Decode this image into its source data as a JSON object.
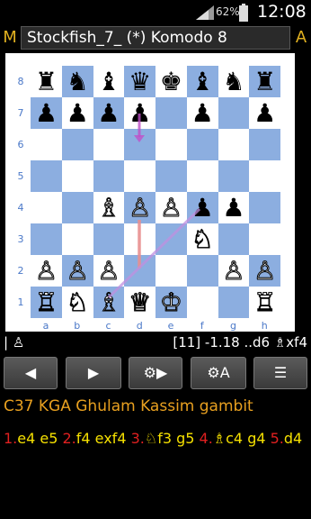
{
  "status": {
    "battery_pct": "62%",
    "time": "12:08"
  },
  "title": {
    "left_btn": "M",
    "text": "Stockfish_7_ (*) Komodo 8",
    "right_btn": "A"
  },
  "board": {
    "ranks": [
      "8",
      "7",
      "6",
      "5",
      "4",
      "3",
      "2",
      "1"
    ],
    "files": [
      "a",
      "b",
      "c",
      "d",
      "e",
      "f",
      "g",
      "h"
    ],
    "pieces": [
      {
        "sq": "a8",
        "p": "♜",
        "c": "b"
      },
      {
        "sq": "b8",
        "p": "♞",
        "c": "b"
      },
      {
        "sq": "c8",
        "p": "♝",
        "c": "b"
      },
      {
        "sq": "d8",
        "p": "♛",
        "c": "b"
      },
      {
        "sq": "e8",
        "p": "♚",
        "c": "b"
      },
      {
        "sq": "f8",
        "p": "♝",
        "c": "b"
      },
      {
        "sq": "g8",
        "p": "♞",
        "c": "b"
      },
      {
        "sq": "h8",
        "p": "♜",
        "c": "b"
      },
      {
        "sq": "a7",
        "p": "♟",
        "c": "b"
      },
      {
        "sq": "b7",
        "p": "♟",
        "c": "b"
      },
      {
        "sq": "c7",
        "p": "♟",
        "c": "b"
      },
      {
        "sq": "d7",
        "p": "♟",
        "c": "b"
      },
      {
        "sq": "f7",
        "p": "♟",
        "c": "b"
      },
      {
        "sq": "h7",
        "p": "♟",
        "c": "b"
      },
      {
        "sq": "c4",
        "p": "♗",
        "c": "w"
      },
      {
        "sq": "d4",
        "p": "♙",
        "c": "w"
      },
      {
        "sq": "e4",
        "p": "♙",
        "c": "w"
      },
      {
        "sq": "f4",
        "p": "♟",
        "c": "b"
      },
      {
        "sq": "g4",
        "p": "♟",
        "c": "b"
      },
      {
        "sq": "f3",
        "p": "♘",
        "c": "w"
      },
      {
        "sq": "a2",
        "p": "♙",
        "c": "w"
      },
      {
        "sq": "b2",
        "p": "♙",
        "c": "w"
      },
      {
        "sq": "c2",
        "p": "♙",
        "c": "w"
      },
      {
        "sq": "g2",
        "p": "♙",
        "c": "w"
      },
      {
        "sq": "h2",
        "p": "♙",
        "c": "w"
      },
      {
        "sq": "a1",
        "p": "♖",
        "c": "w"
      },
      {
        "sq": "b1",
        "p": "♘",
        "c": "w"
      },
      {
        "sq": "c1",
        "p": "♗",
        "c": "w"
      },
      {
        "sq": "d1",
        "p": "♕",
        "c": "w"
      },
      {
        "sq": "e1",
        "p": "♔",
        "c": "w"
      },
      {
        "sq": "h1",
        "p": "♖",
        "c": "w"
      }
    ]
  },
  "info": {
    "cursor": "| ♙",
    "eval": "[11] -1.18 ..d6 ♗xf4"
  },
  "toolbar": {
    "back": "◀",
    "forward": "▶",
    "mode1": "⚙▶",
    "mode2": "⚙A",
    "menu": "☰"
  },
  "game": {
    "opening": "C37 KGA Ghulam Kassim gambit",
    "moves": [
      {
        "n": "1.",
        "t": "e4 e5 "
      },
      {
        "n": "2.",
        "t": "f4 exf4 "
      },
      {
        "n": "3.",
        "t": "♘f3 g5 "
      },
      {
        "n": "4.",
        "t": "♗c4 g4"
      },
      {
        "n": "5.",
        "t": "d4"
      }
    ]
  },
  "colors": {
    "light": "#ffffff",
    "dark": "#8caee0",
    "label": "#4a78c8",
    "move_num": "#e02020",
    "move_text": "#f5e000",
    "opening": "#e8a020"
  }
}
